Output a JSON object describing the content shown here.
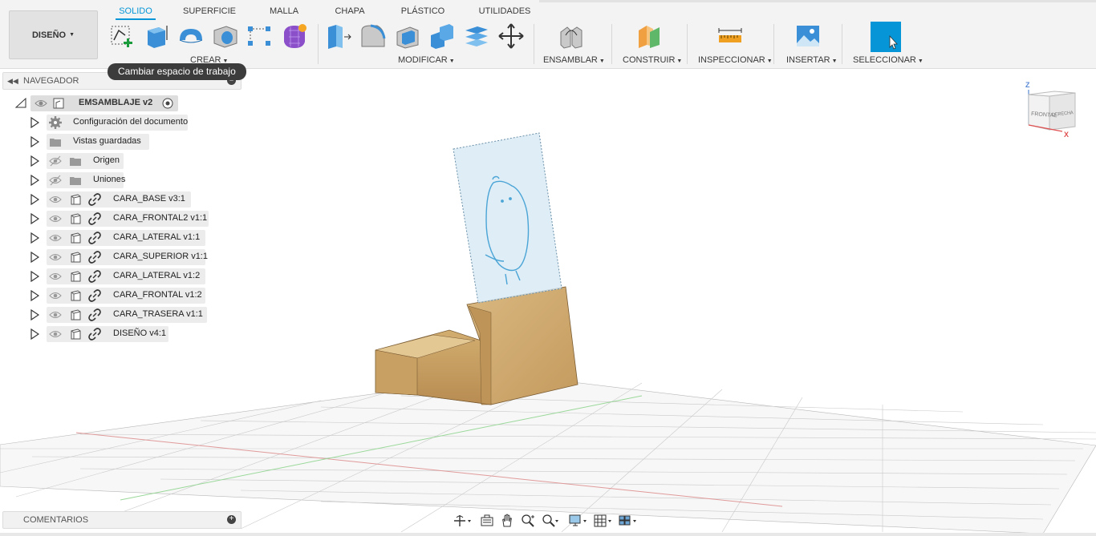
{
  "ribbon": {
    "workspace": {
      "label": "DISEÑO"
    },
    "tabs": [
      {
        "label": "SOLIDO",
        "active": true
      },
      {
        "label": "SUPERFICIE"
      },
      {
        "label": "MALLA"
      },
      {
        "label": "CHAPA"
      },
      {
        "label": "PLÁSTICO"
      },
      {
        "label": "UTILIDADES"
      }
    ],
    "groups": [
      {
        "label": "CREAR"
      },
      {
        "label": "MODIFICAR"
      },
      {
        "label": "ENSAMBLAR"
      },
      {
        "label": "CONSTRUIR"
      },
      {
        "label": "INSPECCIONAR"
      },
      {
        "label": "INSERTAR"
      },
      {
        "label": "SELECCIONAR"
      }
    ],
    "tools": {
      "create": [
        "create-sketch-icon",
        "extrude-icon",
        "revolve-icon",
        "hole-icon",
        "pattern-icon",
        "create-form-icon"
      ],
      "modify": [
        "press-pull-icon",
        "fillet-icon",
        "shell-icon",
        "combine-icon",
        "scale-icon",
        "move-icon"
      ],
      "assemble": [
        "joint-icon"
      ],
      "construct": [
        "offset-plane-icon"
      ],
      "inspect": [
        "measure-icon"
      ],
      "insert": [
        "insert-image-icon"
      ],
      "select": [
        "select-cursor-icon"
      ]
    },
    "accent": "#0696d7"
  },
  "tooltip": {
    "text": "Cambiar espacio de trabajo"
  },
  "navigator": {
    "title": "NAVEGADOR",
    "root": {
      "label": "EMSAMBLAJE v2"
    },
    "items": [
      {
        "label": "Configuración del documento",
        "kind": "settings"
      },
      {
        "label": "Vistas guardadas",
        "kind": "folder"
      },
      {
        "label": "Origen",
        "kind": "folder-hidden"
      },
      {
        "label": "Uniones",
        "kind": "folder-hidden"
      },
      {
        "label": "CARA_BASE v3:1",
        "kind": "component"
      },
      {
        "label": "CARA_FRONTAL2 v1:1",
        "kind": "component"
      },
      {
        "label": "CARA_LATERAL v1:1",
        "kind": "component"
      },
      {
        "label": "CARA_SUPERIOR v1:1",
        "kind": "component"
      },
      {
        "label": "CARA_LATERAL v1:2",
        "kind": "component"
      },
      {
        "label": "CARA_FRONTAL v1:2",
        "kind": "component"
      },
      {
        "label": "CARA_TRASERA v1:1",
        "kind": "component"
      },
      {
        "label": "DISEÑO v4:1",
        "kind": "component"
      }
    ]
  },
  "comments": {
    "title": "COMENTARIOS"
  },
  "viewcube": {
    "face_front": "FRONTAL",
    "face_right": "DERECHA",
    "axis_z": "Z",
    "axis_x": "X"
  },
  "nav_toolbar": [
    "orbit-icon",
    "look-at-icon",
    "pan-icon",
    "zoom-icon",
    "fit-icon",
    "display-settings-icon",
    "grid-settings-icon",
    "viewports-icon"
  ]
}
